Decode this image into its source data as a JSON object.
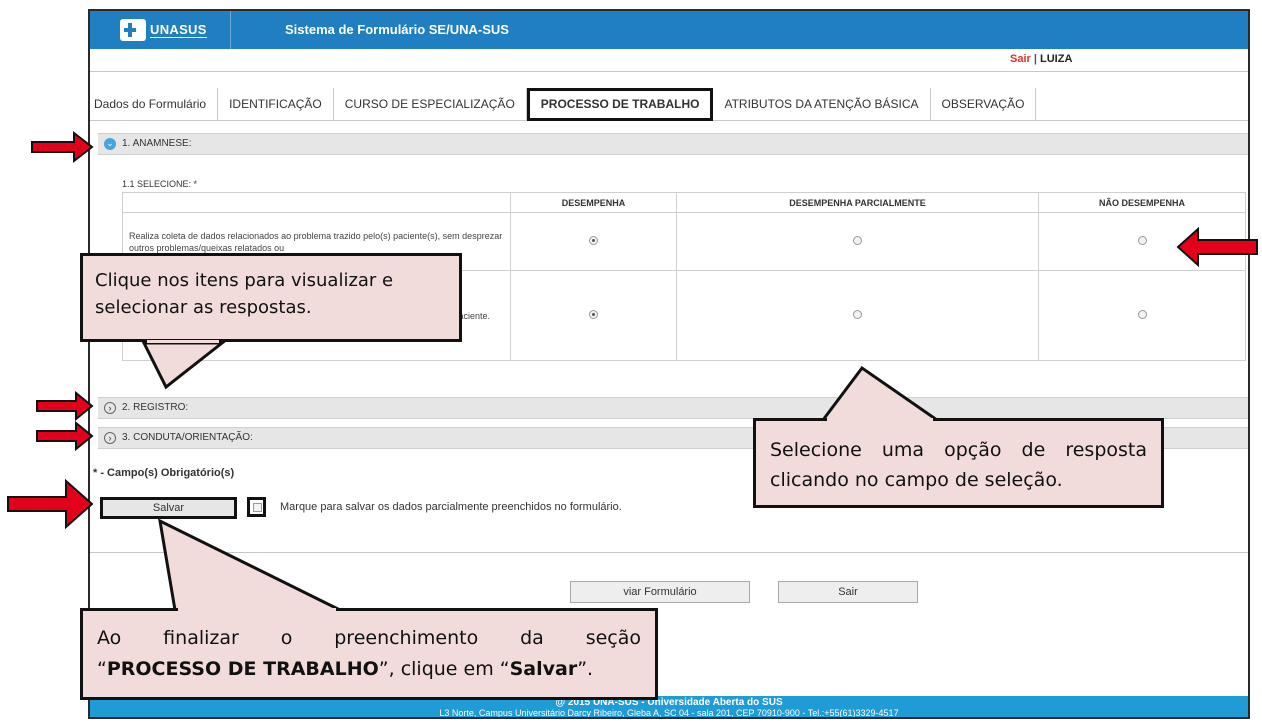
{
  "header": {
    "logo_text": "UNASUS",
    "app_title": "Sistema de Formulário SE/UNA-SUS"
  },
  "userbar": {
    "logout": "Sair",
    "separator": "|",
    "user": "LUIZA"
  },
  "tabs": [
    {
      "label": "Dados do Formulário",
      "active": false
    },
    {
      "label": "IDENTIFICAÇÃO",
      "active": false
    },
    {
      "label": "CURSO DE ESPECIALIZAÇÃO",
      "active": false
    },
    {
      "label": "PROCESSO DE TRABALHO",
      "active": true
    },
    {
      "label": "ATRIBUTOS DA ATENÇÃO BÁSICA",
      "active": false
    },
    {
      "label": "OBSERVAÇÃO",
      "active": false
    }
  ],
  "sections": {
    "s1": {
      "title": "1. ANAMNESE:",
      "icon": "circle-chevron-down-icon",
      "expanded": true
    },
    "s2": {
      "title": "2. REGISTRO:",
      "icon": "circle-chevron-right-icon",
      "expanded": false
    },
    "s3": {
      "title": "3. CONDUTA/ORIENTAÇÃO:",
      "icon": "circle-chevron-right-icon",
      "expanded": false
    }
  },
  "question": {
    "label": "1.1  SELECIONE: *",
    "columns": [
      "",
      "DESEMPENHA",
      "DESEMPENHA PARCIALMENTE",
      "NÃO DESEMPENHA"
    ],
    "rows": [
      {
        "text": "Realiza coleta de dados relacionados ao problema trazido pelo(s) paciente(s), sem desprezar outros problemas/queixas relatados ou",
        "selected": 0
      },
      {
        "text": "nente a ria ais e cial e lo fica do paciente.",
        "selected": 0
      }
    ]
  },
  "form": {
    "required_note": "* - Campo(s) Obrigatório(s)",
    "save_label": "Salvar",
    "partial_label": "Marque para salvar os dados parcialmente preenchidos no formulário.",
    "send_label": "viar Formulário",
    "exit_label": "Sair"
  },
  "footer": {
    "line1": "@ 2015 UNA-SUS - Universidade Aberta do SUS",
    "line2": "L3 Norte, Campus Universitário Darcy Ribeiro, Gleba A, SC 04 - sala 201, CEP 70910-900 - Tel.:+55(61)3329-4517"
  },
  "callouts": {
    "c1": "Clique nos itens para visualizar e selecionar as respostas.",
    "c2": "Selecione uma opção de resposta clicando no campo de seleção.",
    "c3_line1": "Ao finalizar o preenchimento da seção",
    "c3_q1": "“",
    "c3_bold1": "PROCESSO DE TRABALHO",
    "c3_mid": "”, clique em “",
    "c3_bold2": "Salvar",
    "c3_end": "”."
  },
  "colors": {
    "header_blue": "#1f7fc0",
    "footer_blue": "#1f9bd6",
    "arrow_red": "#e4001b",
    "callout_fill": "#f2dcdb",
    "logout_red": "#d3342a"
  }
}
